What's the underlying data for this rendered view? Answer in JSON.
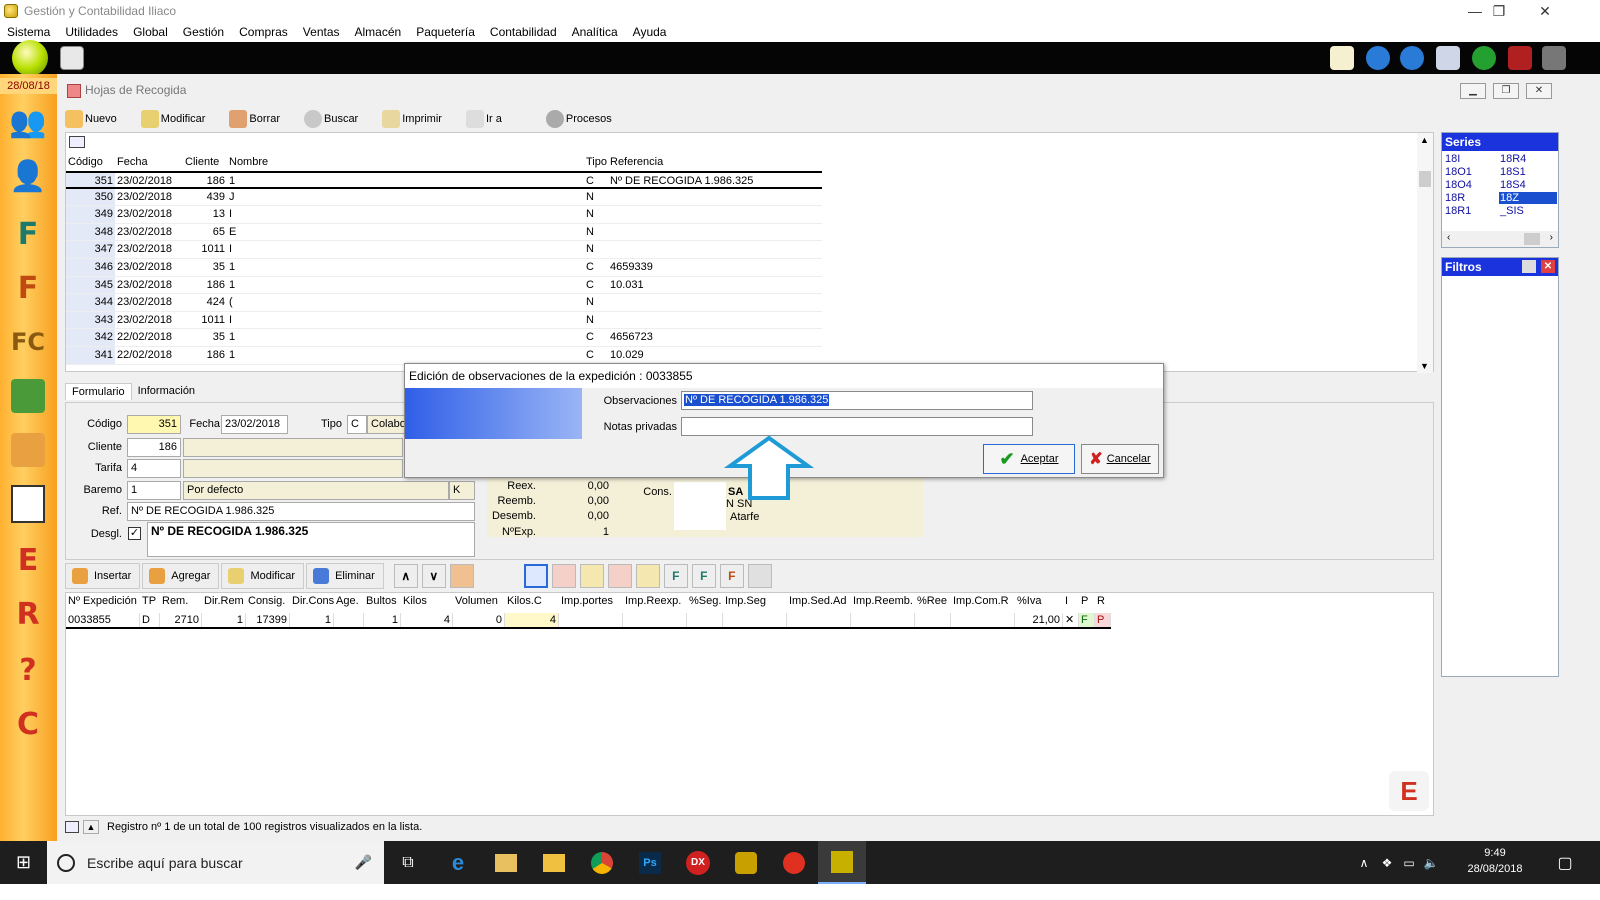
{
  "window": {
    "title": "Gestión y Contabilidad Iliaco",
    "minimize": "—",
    "restore": "❐",
    "close": "✕"
  },
  "menu": [
    "Sistema",
    "Utilidades",
    "Global",
    "Gestión",
    "Compras",
    "Ventas",
    "Almacén",
    "Paquetería",
    "Contabilidad",
    "Analítica",
    "Ayuda"
  ],
  "sidebar": {
    "date": "28/08/18"
  },
  "child_window": {
    "title": "Hojas de Recogida"
  },
  "toolbar": [
    "Nuevo",
    "Modificar",
    "Borrar",
    "Buscar",
    "Imprimir",
    "Ir a",
    "Procesos"
  ],
  "list": {
    "headers": [
      "Código",
      "Fecha",
      "Cliente",
      "Nombre",
      "Tipo",
      "Referencia"
    ],
    "rows": [
      [
        "351",
        "23/02/2018",
        "186",
        "1",
        "C",
        "Nº DE RECOGIDA 1.986.325"
      ],
      [
        "350",
        "23/02/2018",
        "439",
        "J",
        "N",
        ""
      ],
      [
        "349",
        "23/02/2018",
        "13",
        "I",
        "N",
        ""
      ],
      [
        "348",
        "23/02/2018",
        "65",
        "E",
        "N",
        ""
      ],
      [
        "347",
        "23/02/2018",
        "1011",
        "I",
        "N",
        ""
      ],
      [
        "346",
        "23/02/2018",
        "35",
        "1",
        "C",
        "4659339"
      ],
      [
        "345",
        "23/02/2018",
        "186",
        "1",
        "C",
        "10.031"
      ],
      [
        "344",
        "23/02/2018",
        "424",
        "(",
        "N",
        ""
      ],
      [
        "343",
        "23/02/2018",
        "1011",
        "I",
        "N",
        ""
      ],
      [
        "342",
        "22/02/2018",
        "35",
        "1",
        "C",
        "4656723"
      ],
      [
        "341",
        "22/02/2018",
        "186",
        "1",
        "C",
        "10.029"
      ]
    ]
  },
  "series": {
    "title": "Series",
    "items": [
      "18I",
      "18R4",
      "18O1",
      "18S1",
      "18O4",
      "18S4",
      "18R",
      "18Z",
      "18R1",
      "_SIS"
    ]
  },
  "filtros": {
    "title": "Filtros"
  },
  "tabs": [
    "Formulario",
    "Información"
  ],
  "form": {
    "codigo_label": "Código",
    "codigo": "351",
    "fecha_label": "Fecha",
    "fecha": "23/02/2018",
    "tipo_label": "Tipo",
    "tipo": "C",
    "tipo_desc": "Colabor",
    "cliente_label": "Cliente",
    "cliente": "186",
    "tarifa_label": "Tarifa",
    "tarifa": "4",
    "baremo_label": "Baremo",
    "baremo": "1",
    "baremo_desc": "Por defecto",
    "baremo_k": "K",
    "ref_label": "Ref.",
    "ref": "Nº DE RECOGIDA 1.986.325",
    "desgl_label": "Desgl.",
    "desgl_text": "Nº DE RECOGIDA 1.986.325",
    "reex_label": "Reex.",
    "reex": "0,00",
    "reemb_label": "Reemb.",
    "reemb": "0,00",
    "desemb_label": "Desemb.",
    "desemb": "0,00",
    "nexp_label": "NºExp.",
    "nexp": "1",
    "cons_label": "Cons.",
    "cons_1": "SA",
    "cons_2": "N SN",
    "cons_3": "Atarfe"
  },
  "actions": [
    "Insertar",
    "Agregar",
    "Modificar",
    "Eliminar"
  ],
  "exp_grid": {
    "headers": [
      "Nº Expedición",
      "TP",
      "Rem.",
      "Dir.Rem",
      "Consig.",
      "Dir.Cons",
      "Age.",
      "Bultos",
      "Kilos",
      "Volumen",
      "Kilos.C",
      "Imp.portes",
      "Imp.Reexp.",
      "%Seg.",
      "Imp.Seg",
      "Imp.Sed.Ad",
      "Imp.Reemb.",
      "%Ree",
      "Imp.Com.R",
      "%Iva",
      "I",
      "P",
      "R"
    ],
    "row": [
      "0033855",
      "D",
      "2710",
      "1",
      "17399",
      "1",
      "",
      "1",
      "4",
      "0",
      "4",
      "",
      "",
      "",
      "",
      "",
      "",
      "",
      "",
      "21,00",
      "✕",
      "F",
      "P"
    ]
  },
  "status": "Registro nº 1 de un total de 100 registros visualizados en la lista.",
  "dialog": {
    "title": "Edición de observaciones de la expedición : 0033855",
    "obs_label": "Observaciones",
    "obs_value": "Nº DE RECOGIDA 1.986.325",
    "notas_label": "Notas privadas",
    "notas_value": "",
    "ok": "Aceptar",
    "cancel": "Cancelar"
  },
  "taskbar": {
    "search_placeholder": "Escribe aquí para buscar",
    "time": "9:49",
    "date": "28/08/2018"
  },
  "colors": {
    "accent_blue": "#1a33dd",
    "sidebar_orange": "#ffb030",
    "selected": "#1a4fd0"
  }
}
